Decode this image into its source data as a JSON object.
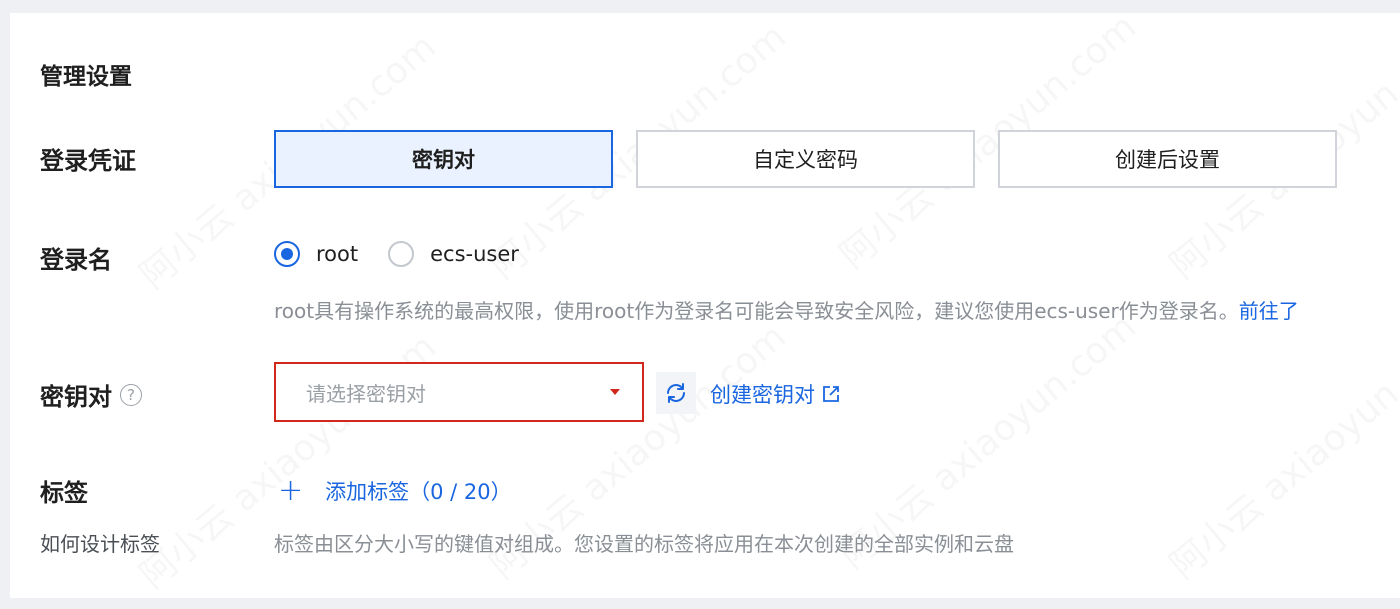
{
  "section_title": "管理设置",
  "credential": {
    "label": "登录凭证",
    "options": [
      "密钥对",
      "自定义密码",
      "创建后设置"
    ],
    "selected_index": 0
  },
  "login_name": {
    "label": "登录名",
    "options": [
      "root",
      "ecs-user"
    ],
    "selected": "root",
    "hint": "root具有操作系统的最高权限，使用root作为登录名可能会导致安全风险，建议您使用ecs-user作为登录名。",
    "hint_link": "前往了"
  },
  "key_pair": {
    "label": "密钥对",
    "help_icon": "?",
    "placeholder": "请选择密钥对",
    "create_link": "创建密钥对"
  },
  "tags": {
    "label": "标签",
    "sub_label": "如何设计标签",
    "add_label": "添加标签（0 / 20）",
    "hint": "标签由区分大小写的键值对组成。您设置的标签将应用在本次创建的全部实例和云盘"
  },
  "watermark": "阿小云 axiaoyun.com",
  "colors": {
    "accent": "#1a66e0",
    "error": "#d0281b"
  }
}
